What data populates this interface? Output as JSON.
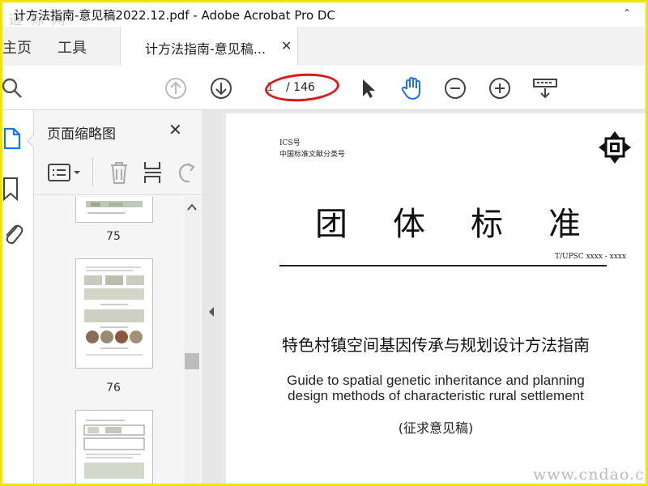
{
  "window": {
    "title": "计方法指南-意见稿2022.12.pdf - Adobe Acrobat Pro DC",
    "collapse_glyph": "⌃",
    "watermark_top": "道 标 网"
  },
  "tabs": {
    "home": "主页",
    "tools": "工具",
    "document_tab": "计方法指南-意见稿...",
    "close_glyph": "✕"
  },
  "toolbar": {
    "icons": [
      "search-icon",
      "page-up-icon",
      "page-down-icon",
      "select-cursor-icon",
      "hand-icon",
      "zoom-out-icon",
      "zoom-in-icon",
      "keyboard-scroll-icon"
    ],
    "current_page": "1",
    "total_pages": "/ 146",
    "active_color": "#1a73e8",
    "annotation_color": "#d81a1a"
  },
  "thumbnail_panel": {
    "title": "页面缩略图",
    "close_glyph": "✕",
    "thumbnails": [
      {
        "number": "75"
      },
      {
        "number": "76"
      },
      {
        "number": ""
      }
    ]
  },
  "document": {
    "ics": "ICS号",
    "classification": "中国标准文献分类号",
    "big_title": "团体标准",
    "standard_number": "T/UPSC  xxxx - xxxx",
    "chinese_title": "特色村镇空间基因传承与规划设计方法指南",
    "english_title_line1": "Guide to spatial genetic inheritance and planning",
    "english_title_line2": "design methods of characteristic rural settlement",
    "draft_note": "(征求意见稿)"
  },
  "watermark_bottom": "www.cndao.com",
  "colors": {
    "frame_border": "#f2e400",
    "tab_bar": "#f2f2f2",
    "panel_bg": "#f5f5f5"
  }
}
